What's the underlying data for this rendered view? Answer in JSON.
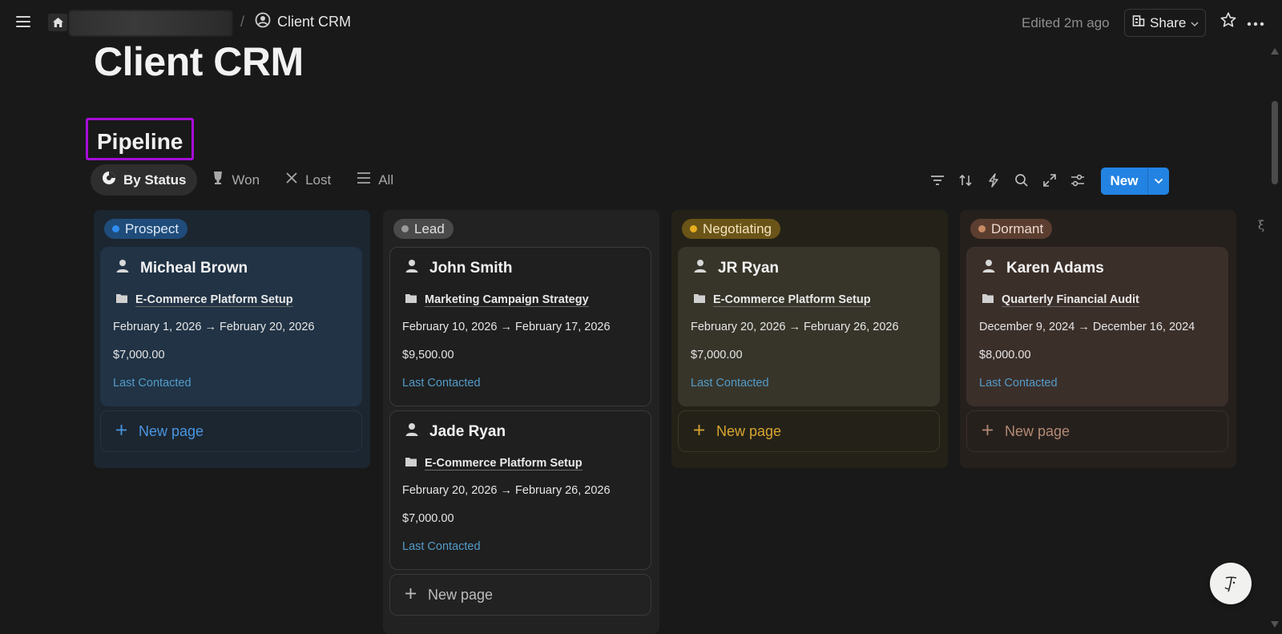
{
  "topbar": {
    "page_name": "Client CRM",
    "separator": "/",
    "edited": "Edited 2m ago",
    "share_label": "Share"
  },
  "page": {
    "title": "Client CRM",
    "section_title": "Pipeline"
  },
  "tabs": [
    {
      "label": "By Status",
      "icon": "pie-chart-icon",
      "active": true
    },
    {
      "label": "Won",
      "icon": "trophy-icon",
      "active": false
    },
    {
      "label": "Lost",
      "icon": "close-icon",
      "active": false
    },
    {
      "label": "All",
      "icon": "list-icon",
      "active": false
    }
  ],
  "toolbar": {
    "icons": [
      "filter-icon",
      "sort-icon",
      "automation-icon",
      "search-icon",
      "expand-icon",
      "settings-icon"
    ],
    "new_label": "New"
  },
  "columns": [
    {
      "status": "Prospect",
      "pill_bg": "#1f4c7a",
      "dot": "#2f8cf0",
      "text_color": "#dbe9f7",
      "card_bg": "#213345",
      "card_border": "#213345",
      "new_page_color": "#4a96e0",
      "new_page_border": "#243444",
      "cards": [
        {
          "name": "Micheal Brown",
          "project": "E-Commerce Platform Setup",
          "dates": "February 1, 2026 → February 20, 2026",
          "amount": "$7,000.00",
          "last_contacted": "Last Contacted"
        }
      ],
      "new_page": "New page"
    },
    {
      "status": "Lead",
      "pill_bg": "#4a4a4a",
      "dot": "#9a9a9a",
      "text_color": "#e0e0e0",
      "card_bg": "#1f1f1f",
      "card_border": "#3a3a3a",
      "new_page_color": "#bdbdbd",
      "new_page_border": "#3a3a3a",
      "cards": [
        {
          "name": "John Smith",
          "project": "Marketing Campaign Strategy",
          "dates": "February 10, 2026 → February 17, 2026",
          "amount": "$9,500.00",
          "last_contacted": "Last Contacted"
        },
        {
          "name": "Jade Ryan",
          "project": "E-Commerce Platform Setup",
          "dates": "February 20, 2026 → February 26, 2026",
          "amount": "$7,000.00",
          "last_contacted": "Last Contacted"
        }
      ],
      "new_page": "New page"
    },
    {
      "status": "Negotiating",
      "pill_bg": "#6b5417",
      "dot": "#e6ae1e",
      "text_color": "#f1e3bd",
      "card_bg": "#37352a",
      "card_border": "#37352a",
      "new_page_color": "#d9a531",
      "new_page_border": "#3a3726",
      "cards": [
        {
          "name": "JR Ryan",
          "project": "E-Commerce Platform Setup",
          "dates": "February 20, 2026 → February 26, 2026",
          "amount": "$7,000.00",
          "last_contacted": "Last Contacted"
        }
      ],
      "new_page": "New page"
    },
    {
      "status": "Dormant",
      "pill_bg": "#5b3e30",
      "dot": "#c88a65",
      "text_color": "#ecd9cd",
      "card_bg": "#3b2f2a",
      "card_border": "#3b2f2a",
      "new_page_color": "#b38a74",
      "new_page_border": "#3a2e28",
      "cards": [
        {
          "name": "Karen Adams",
          "project": "Quarterly Financial Audit",
          "dates": "December 9, 2024 → December 16, 2024",
          "amount": "$8,000.00",
          "last_contacted": "Last Contacted"
        }
      ],
      "new_page": "New page"
    }
  ]
}
